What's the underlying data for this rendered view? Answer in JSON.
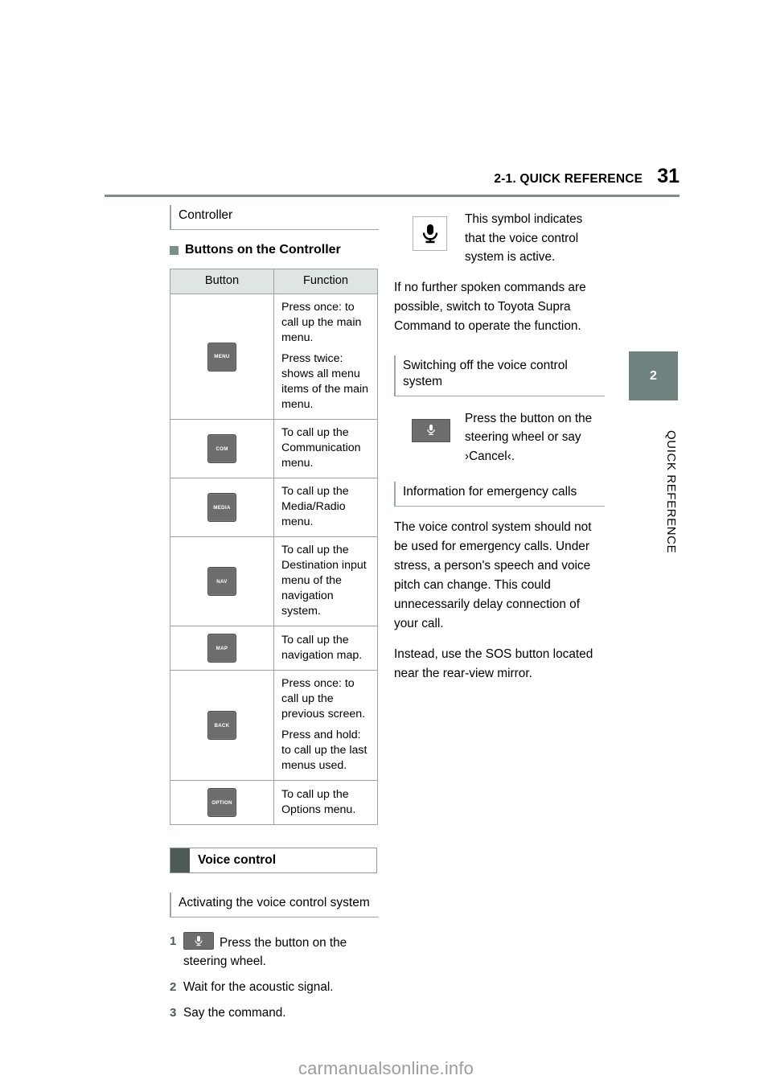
{
  "header": {
    "chapter": "2-1. QUICK REFERENCE",
    "page_number": "31",
    "rule_color": "#7b8e8b"
  },
  "chapter_tab": {
    "number": "2",
    "vertical_label": "QUICK REFERENCE",
    "color": "#6f8280"
  },
  "left_column": {
    "section_heading": "Controller",
    "bullet_heading": "Buttons on the Controller",
    "table": {
      "headers": [
        "Button",
        "Function"
      ],
      "rows": [
        {
          "button": "MENU",
          "paragraphs": [
            "Press once: to call up the main menu.",
            "Press twice: shows all menu items of the main menu."
          ]
        },
        {
          "button": "COM",
          "paragraphs": [
            "To call up the Communication menu."
          ]
        },
        {
          "button": "MEDIA",
          "paragraphs": [
            "To call up the Media/Radio menu."
          ]
        },
        {
          "button": "NAV",
          "paragraphs": [
            "To call up the Destination input menu of the navigation system."
          ]
        },
        {
          "button": "MAP",
          "paragraphs": [
            "To call up the navigation map."
          ]
        },
        {
          "button": "BACK",
          "paragraphs": [
            "Press once: to call up the previous screen.",
            "Press and hold: to call up the last menus used."
          ]
        },
        {
          "button": "OPTION",
          "paragraphs": [
            "To call up the Options menu."
          ]
        }
      ]
    },
    "voice_control_bar": "Voice control",
    "activating_heading": "Activating the voice control system",
    "steps": [
      {
        "num": "1",
        "text": "Press the button on the steering wheel.",
        "has_mic": true
      },
      {
        "num": "2",
        "text": "Wait for the acoustic signal.",
        "has_mic": false
      },
      {
        "num": "3",
        "text": "Say the command.",
        "has_mic": false
      }
    ]
  },
  "right_column": {
    "symbol_note": "This symbol indicates that the voice control system is active.",
    "paragraph_1": "If no further spoken commands are possible, switch to Toyota Supra Command to operate the function.",
    "switching_off_heading": "Switching off the voice control system",
    "switching_off_note": "Press the button on the steering wheel or say ›Cancel‹.",
    "emergency_heading": "Information for emergency calls",
    "emergency_paragraph_1": "The voice control system should not be used for emergency calls. Under stress, a person's speech and voice pitch can change. This could unnecessarily delay connection of your call.",
    "emergency_paragraph_2": "Instead, use the SOS button located near the rear-view mirror."
  },
  "watermark": "carmanualsonline.info"
}
